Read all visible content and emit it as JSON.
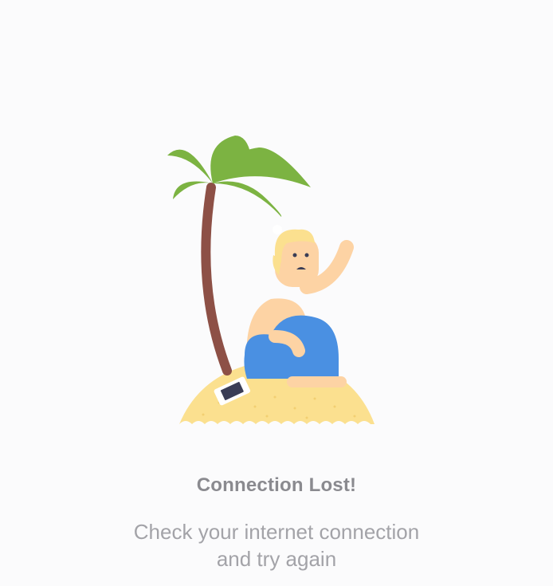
{
  "error_state": {
    "illustration": "stranded-on-island-icon",
    "title": "Connection Lost!",
    "message_line1": "Check your internet connection",
    "message_line2": "and try again"
  },
  "colors": {
    "background": "#fbfbfc",
    "title": "#8a8a8f",
    "message": "#a3a3a8",
    "palm_leaves": "#7cb342",
    "palm_trunk": "#8d5046",
    "sand": "#fbe08f",
    "skin": "#fdd3a4",
    "hair": "#fbe08f",
    "shorts": "#4a90e2"
  }
}
